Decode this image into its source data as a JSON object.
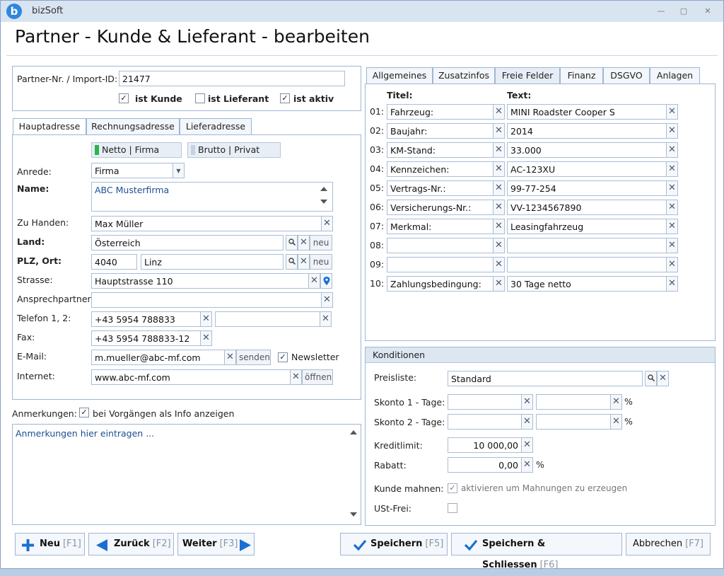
{
  "window": {
    "app_title": "bizSoft",
    "logo_letter": "b",
    "minimize": "▭",
    "maximize": "▢",
    "close": "✕"
  },
  "page_title": "Partner - Kunde & Lieferant - bearbeiten",
  "partner": {
    "id_label": "Partner-Nr. / Import-ID:",
    "id_value": "21477",
    "ist_kunde_label": "ist Kunde",
    "ist_kunde": true,
    "ist_lieferant_label": "ist Lieferant",
    "ist_lieferant": false,
    "ist_aktiv_label": "ist aktiv",
    "ist_aktiv": true
  },
  "address_tabs": [
    "Hauptadresse",
    "Rechnungsadresse",
    "Lieferadresse"
  ],
  "address": {
    "netto_label": "Netto | Firma",
    "brutto_label": "Brutto | Privat",
    "anrede_label": "Anrede:",
    "anrede_value": "Firma",
    "name_label": "Name:",
    "name_value": "ABC Musterfirma",
    "zuhanden_label": "Zu Handen:",
    "zuhanden_value": "Max Müller",
    "land_label": "Land:",
    "land_value": "Österreich",
    "plz_label": "PLZ, Ort:",
    "plz_value": "4040",
    "ort_value": "Linz",
    "neu_label": "neu",
    "strasse_label": "Strasse:",
    "strasse_value": "Hauptstrasse 110",
    "ansprech_label": "Ansprechpartner:",
    "ansprech_value": "",
    "telefon_label": "Telefon 1, 2:",
    "telefon1_value": "+43 5954 788833",
    "telefon2_value": "",
    "fax_label": "Fax:",
    "fax_value": "+43 5954 788833-12",
    "email_label": "E-Mail:",
    "email_value": "m.mueller@abc-mf.com",
    "senden_label": "senden",
    "newsletter_label": "Newsletter",
    "newsletter": true,
    "internet_label": "Internet:",
    "internet_value": "www.abc-mf.com",
    "oeffnen_label": "öffnen"
  },
  "notes": {
    "label": "Anmerkungen:",
    "info_label": "bei Vorgängen als Info anzeigen",
    "info_checked": true,
    "placeholder": "Anmerkungen hier eintragen ..."
  },
  "right_tabs": [
    "Allgemeines",
    "Zusatzinfos",
    "Freie Felder",
    "Finanz",
    "DSGVO",
    "Anlagen"
  ],
  "free_fields": {
    "titel_header": "Titel:",
    "text_header": "Text:",
    "rows": [
      {
        "num": "01:",
        "title": "Fahrzeug:",
        "text": "MINI Roadster Cooper S"
      },
      {
        "num": "02:",
        "title": "Baujahr:",
        "text": "2014"
      },
      {
        "num": "03:",
        "title": "KM-Stand:",
        "text": "33.000"
      },
      {
        "num": "04:",
        "title": "Kennzeichen:",
        "text": "AC-123XU"
      },
      {
        "num": "05:",
        "title": "Vertrags-Nr.:",
        "text": "99-77-254"
      },
      {
        "num": "06:",
        "title": "Versicherungs-Nr.:",
        "text": "VV-1234567890"
      },
      {
        "num": "07:",
        "title": "Merkmal:",
        "text": "Leasingfahrzeug"
      },
      {
        "num": "08:",
        "title": "",
        "text": ""
      },
      {
        "num": "09:",
        "title": "",
        "text": ""
      },
      {
        "num": "10:",
        "title": "Zahlungsbedingung:",
        "text": "30 Tage netto"
      }
    ]
  },
  "konditionen": {
    "header": "Konditionen",
    "preisliste_label": "Preisliste:",
    "preisliste_value": "Standard",
    "skonto1_label": "Skonto 1 - Tage:",
    "skonto2_label": "Skonto 2 - Tage:",
    "percent": "%",
    "kreditlimit_label": "Kreditlimit:",
    "kreditlimit_value": "10 000,00",
    "rabatt_label": "Rabatt:",
    "rabatt_value": "0,00",
    "mahnen_label": "Kunde mahnen:",
    "mahnen_hint": "aktivieren um Mahnungen zu erzeugen",
    "mahnen_checked": true,
    "ust_label": "USt-Frei:",
    "ust_checked": false
  },
  "buttons": {
    "neu": "Neu",
    "neu_key": "[F1]",
    "zurueck": "Zurück",
    "zurueck_key": "[F2]",
    "weiter": "Weiter",
    "weiter_key": "[F3]",
    "speichern": "Speichern",
    "speichern_key": "[F5]",
    "speichern_schliessen": "Speichern & Schliessen",
    "speichern_schliessen_key": "[F6]",
    "abbrechen": "Abbrechen",
    "abbrechen_key": "[F7]"
  },
  "colors": {
    "netto_bar": "#2db34a",
    "brutto_bar": "#c4d2e4",
    "accent": "#1a6fd1"
  }
}
